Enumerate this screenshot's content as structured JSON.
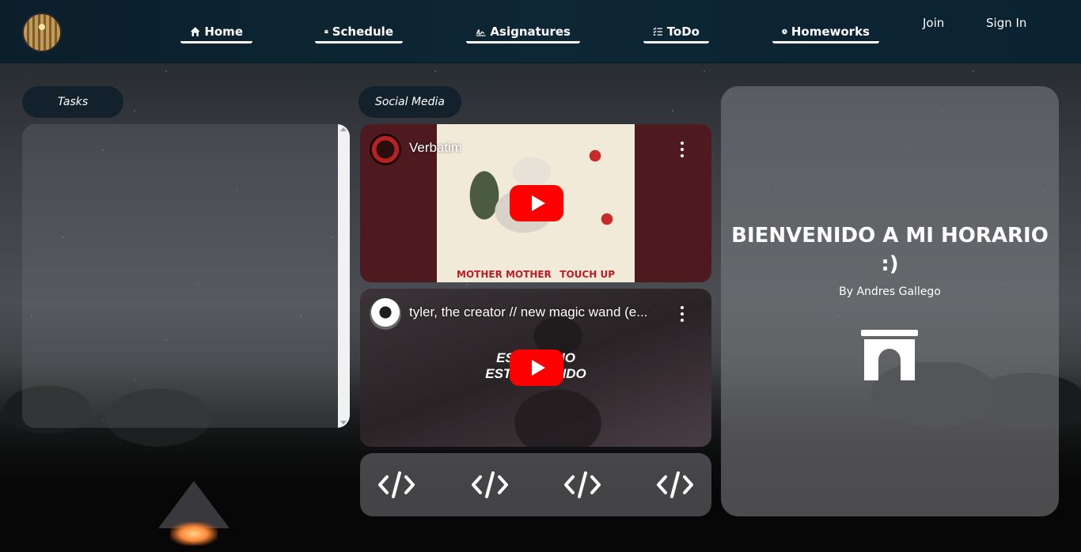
{
  "nav": {
    "items": [
      {
        "label": "Home",
        "icon": "home-icon"
      },
      {
        "label": "Schedule",
        "icon": "calendar-icon"
      },
      {
        "label": "Asignatures",
        "icon": "signature-icon"
      },
      {
        "label": "ToDo",
        "icon": "checklist-icon"
      },
      {
        "label": "Homeworks",
        "icon": "clock-icon"
      }
    ],
    "join": "Join",
    "sign_in": "Sign In"
  },
  "tasks": {
    "label": "Tasks"
  },
  "social": {
    "label": "Social Media",
    "videos": [
      {
        "title": "Verbatim",
        "thumbnail_caption_left": "MOTHER MOTHER",
        "thumbnail_caption_right": "TOUCH UP"
      },
      {
        "title": "tyler, the creator // new magic wand (e...",
        "overlay_line1": "ESTO      40 NO",
        "overlay_line2": "ESTÁ F      NANDO"
      }
    ]
  },
  "welcome": {
    "title": "BIENVENIDO A MI HORARIO :)",
    "byline": "By Andres Gallego"
  },
  "colors": {
    "navbar": "#0e2735",
    "pill": "#13212c",
    "youtube_red": "#ff0000"
  }
}
